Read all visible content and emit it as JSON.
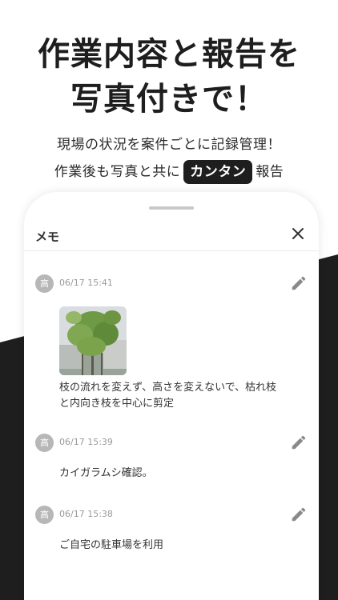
{
  "promo": {
    "headline_line1": "作業内容と報告を",
    "headline_line2": "写真付きで！",
    "sub_line1": "現場の状況を案件ごとに記録管理！",
    "sub_line2_prefix": "作業後も写真と共に",
    "sub_line2_pill": "カンタン",
    "sub_line2_suffix": "報告"
  },
  "memo": {
    "title": "メモ",
    "close_icon": "close-icon",
    "entries": [
      {
        "avatar": "高",
        "timestamp": "06/17 15:41",
        "has_photo": true,
        "text_line1": "枝の流れを変えず、高さを変えないで、枯れ枝",
        "text_line2": "と内向き枝を中心に剪定"
      },
      {
        "avatar": "高",
        "timestamp": "06/17 15:39",
        "text_line1": "カイガラムシ確認。"
      },
      {
        "avatar": "高",
        "timestamp": "06/17 15:38",
        "text_line1": "ご自宅の駐車場を利用"
      }
    ]
  },
  "colors": {
    "dark": "#1e1e1e",
    "avatar_bg": "#b7b7b7",
    "timestamp": "#9a9a9a"
  }
}
